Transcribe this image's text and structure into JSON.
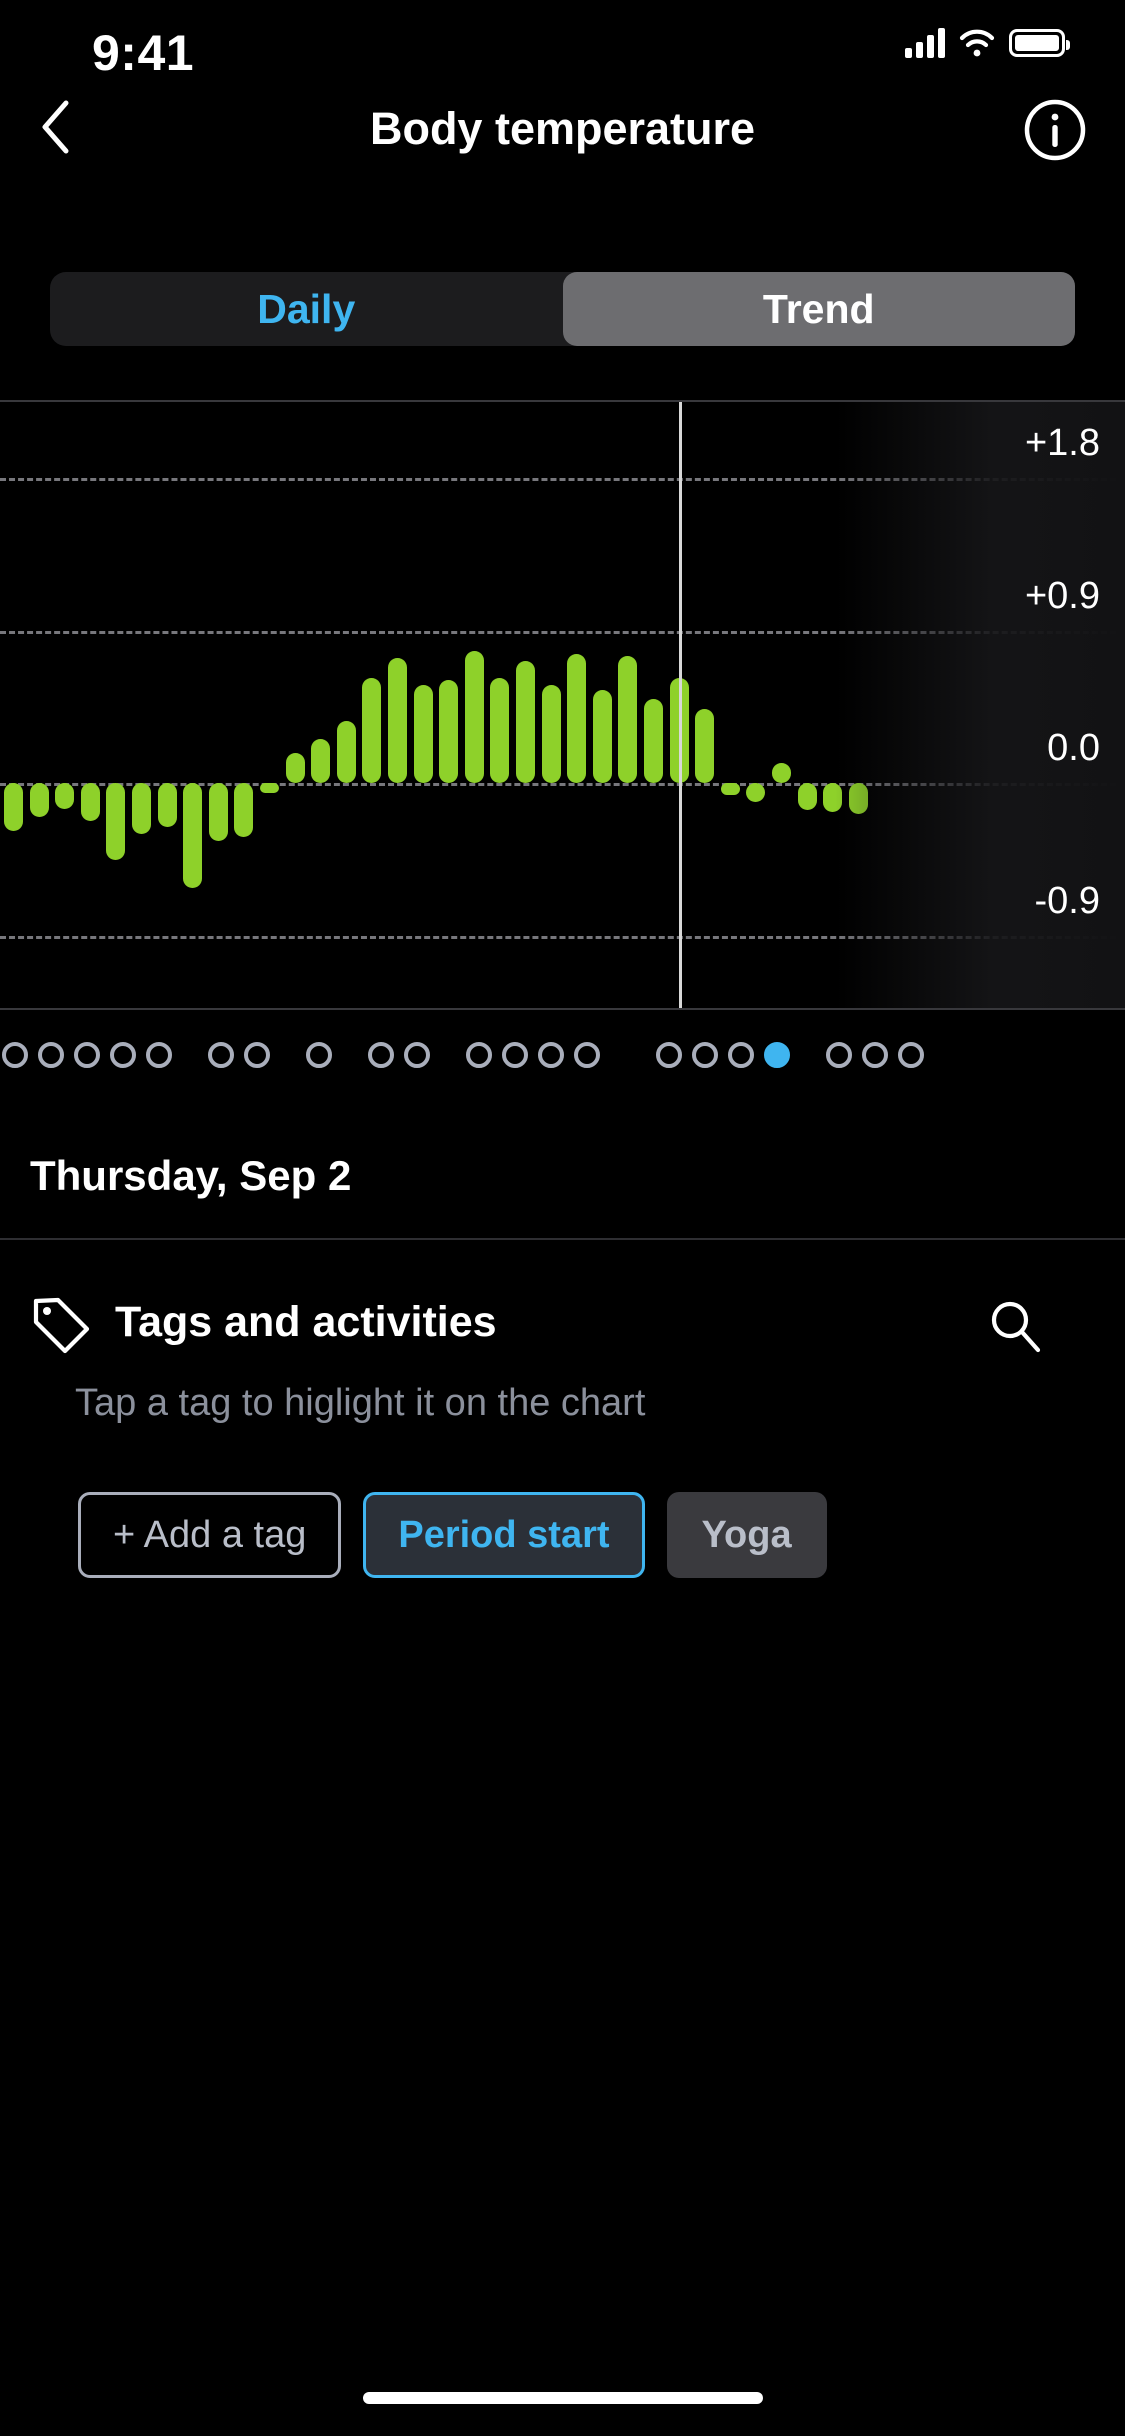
{
  "status_bar": {
    "time": "9:41",
    "cellular_icon": "signal-bars-icon",
    "wifi_icon": "wifi-icon",
    "battery_icon": "battery-full-icon"
  },
  "nav": {
    "back_icon": "chevron-left-icon",
    "title": "Body temperature",
    "info_icon": "info-circle-icon"
  },
  "segmented_control": {
    "options": [
      {
        "label": "Daily",
        "selected": false
      },
      {
        "label": "Trend",
        "selected": true
      }
    ],
    "inactive_color": "#3fb5f0",
    "active_bg": "#6d6d70",
    "track_bg": "#1c1c1e"
  },
  "chart_data": {
    "type": "bar",
    "title": "Body temperature",
    "xlabel": "",
    "ylabel": "",
    "grid": true,
    "legend": false,
    "bar_color": "#8ed12a",
    "cursor_color": "#d8d8d8",
    "cursor_index": 26,
    "selected_date": "Thursday,  Sep 2",
    "ylim": [
      -1.35,
      2.25
    ],
    "yticks": [
      1.8,
      0.9,
      0.0,
      -0.9
    ],
    "ytick_labels": [
      "+1.8",
      "+0.9",
      "0.0",
      "-0.9"
    ],
    "unit": "°",
    "values": [
      -0.28,
      -0.2,
      -0.15,
      -0.22,
      -0.45,
      -0.3,
      -0.26,
      -0.62,
      -0.34,
      -0.32,
      -0.06,
      0.18,
      0.26,
      0.37,
      0.62,
      0.74,
      0.58,
      0.61,
      0.78,
      0.62,
      0.72,
      0.58,
      0.76,
      0.55,
      0.75,
      0.5,
      0.62,
      0.44,
      -0.07,
      -0.11,
      0.12,
      -0.16,
      -0.17,
      -0.18
    ]
  },
  "pagination": {
    "total": 21,
    "selected_index": 17,
    "groups": [
      5,
      2,
      1,
      2,
      4,
      4,
      3
    ],
    "dot_color": "#a9aebb",
    "selected_color": "#3fb5f0"
  },
  "date_label": "Thursday,  Sep 2",
  "tags_section": {
    "tag_icon": "tag-icon",
    "title": "Tags and activities",
    "search_icon": "search-icon",
    "subtitle": "Tap a tag to higlight it on the chart",
    "chips": [
      {
        "label": "+ Add a tag",
        "style": "outline"
      },
      {
        "label": "Period start",
        "style": "selected"
      },
      {
        "label": "Yoga",
        "style": "filled"
      }
    ]
  },
  "home_indicator": "home-indicator"
}
